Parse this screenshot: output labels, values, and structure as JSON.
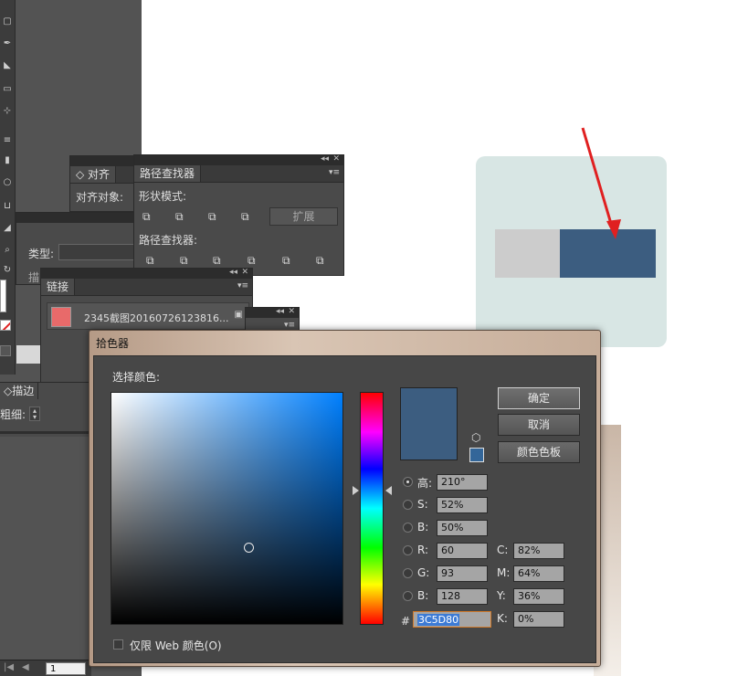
{
  "colors": {
    "selected": "#3C5D80",
    "card": "#d8e6e4",
    "bar_gray": "#cccccc",
    "arrow": "#e02020",
    "link_thumb": "#e86a6a"
  },
  "align_panel": {
    "tab": "对齐",
    "label": "对齐对象:"
  },
  "pathfinder_panel": {
    "tab": "路径查找器",
    "shape_modes_label": "形状模式:",
    "expand_button": "扩展",
    "pathfinders_label": "路径查找器:"
  },
  "type_panel": {
    "type_label": "类型:",
    "desc_label": "描"
  },
  "links_panel": {
    "tab": "链接",
    "item_name": "2345截图20160726123816..."
  },
  "stroke_panel": {
    "tab": "描边",
    "weight_label": "粗细:"
  },
  "statusbar": {
    "page": "1"
  },
  "picker": {
    "title": "拾色器",
    "select_label": "选择颜色:",
    "buttons": {
      "ok": "确定",
      "cancel": "取消",
      "swatches": "颜色色板"
    },
    "fields": {
      "h": {
        "label": "高:",
        "value": "210°",
        "selected": true
      },
      "s": {
        "label": "S:",
        "value": "52%"
      },
      "b": {
        "label": "B:",
        "value": "50%"
      },
      "r": {
        "label": "R:",
        "value": "60"
      },
      "g": {
        "label": "G:",
        "value": "93"
      },
      "bl": {
        "label": "B:",
        "value": "128"
      },
      "c": {
        "label": "C:",
        "value": "82%"
      },
      "m": {
        "label": "M:",
        "value": "64%"
      },
      "y": {
        "label": "Y:",
        "value": "36%"
      },
      "k": {
        "label": "K:",
        "value": "0%"
      }
    },
    "hex": {
      "label": "#",
      "value": "3C5D80"
    },
    "web_only_label": "仅限 Web 颜色(O)"
  }
}
